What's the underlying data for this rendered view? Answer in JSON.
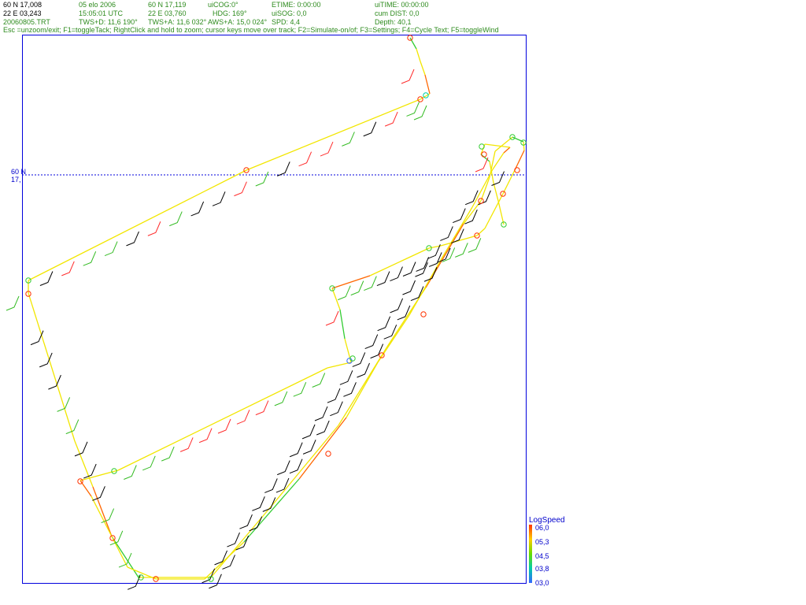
{
  "status": {
    "row1": [
      "60 N 17,008",
      "05 elo 2006",
      "60 N 17,119",
      "uiCOG:0°",
      "ETIME: 0:00:00",
      "uiTIME: 00:00:00"
    ],
    "row2": [
      "22 E 03,243",
      "15:05:01  UTC",
      "22 E 03,760",
      "HDG: 169°",
      "uiSOG: 0,0",
      "cum DIST: 0,0"
    ],
    "row3": [
      "20060805.TRT",
      "TWS+D: 11,6 190°",
      "TWS+A: 11,6 032°",
      "AWS+A: 15,0 024°",
      "SPD: 4,4",
      "Depth: 40,1"
    ]
  },
  "help_text": "Esc =unzoom/exit; F1=toggleTack; RightClick and hold to zoom; cursor keys move over track; F2=Simulate-on/of; F3=Settings; F4=Cycle Text; F5=toggleWind",
  "lat_line": {
    "label1": "60 N",
    "label2": "17,"
  },
  "legend": {
    "title": "LogSpeed",
    "labels": [
      "06,0",
      "05,3",
      "04,5",
      "03,8",
      "03,0"
    ],
    "colors": [
      "#ff3300",
      "#ffcc00",
      "#66dd00",
      "#00ccaa",
      "#3366ff"
    ]
  },
  "colors": {
    "frame": "#0000dd",
    "track_fast": "#ff6600",
    "track_mid": "#f2e600",
    "track_slow": "#33cc33",
    "wind_black": "#000000",
    "wind_red": "#ff2a2a",
    "wind_green": "#33bb22"
  }
}
